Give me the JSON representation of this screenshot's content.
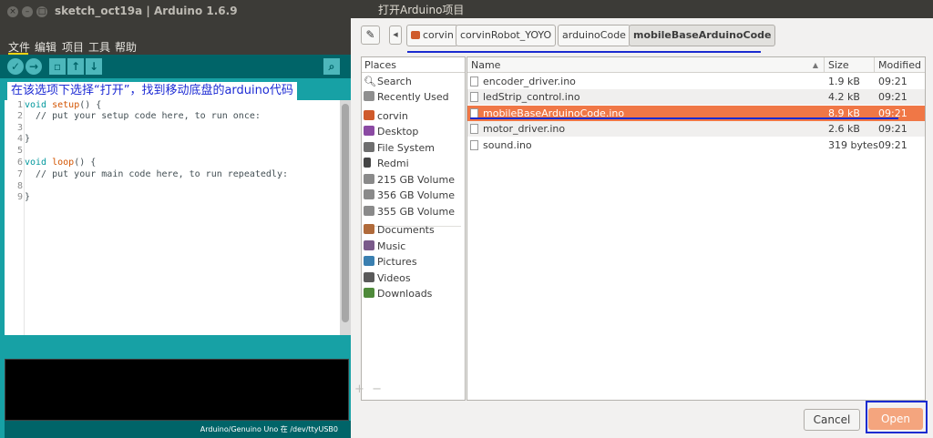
{
  "ide": {
    "title": "sketch_oct19a | Arduino 1.6.9",
    "menu": [
      "文件",
      "编辑",
      "项目",
      "工具",
      "帮助"
    ],
    "annotation": "在该选项下选择“打开”，找到移动底盘的arduino代码",
    "line_numbers": [
      "1",
      "2",
      "3",
      "4",
      "5",
      "6",
      "7",
      "8",
      "9"
    ],
    "code": {
      "l1_kw": "void",
      "l1_fn": "setup",
      "l1_rest": "() {",
      "l2": "  // put your setup code here, to run once:",
      "l4": "}",
      "l6_kw": "void",
      "l6_fn": "loop",
      "l6_rest": "() {",
      "l7": "  // put your main code here, to run repeatedly:",
      "l9": "}"
    },
    "status": "Arduino/Genuino Uno 在 /dev/ttyUSB0"
  },
  "dialog": {
    "title": "打开Arduino项目",
    "breadcrumbs": [
      "corvin",
      "corvinRobot_YOYO",
      "arduinoCode",
      "mobileBaseArduinoCode"
    ],
    "places_header": "Places",
    "places": [
      {
        "label": "Search",
        "icon": "search-icon"
      },
      {
        "label": "Recently Used",
        "icon": "recent-icon"
      },
      {
        "label": "corvin",
        "icon": "home-folder-icon"
      },
      {
        "label": "Desktop",
        "icon": "desktop-icon"
      },
      {
        "label": "File System",
        "icon": "filesystem-icon"
      },
      {
        "label": "Redmi",
        "icon": "phone-icon"
      },
      {
        "label": "215 GB Volume",
        "icon": "drive-icon"
      },
      {
        "label": "356 GB Volume",
        "icon": "drive-icon"
      },
      {
        "label": "355 GB Volume",
        "icon": "drive-icon"
      },
      {
        "label": "Documents",
        "icon": "documents-folder-icon"
      },
      {
        "label": "Music",
        "icon": "music-folder-icon"
      },
      {
        "label": "Pictures",
        "icon": "pictures-folder-icon"
      },
      {
        "label": "Videos",
        "icon": "videos-folder-icon"
      },
      {
        "label": "Downloads",
        "icon": "downloads-folder-icon"
      }
    ],
    "columns": {
      "name": "Name",
      "size": "Size",
      "modified": "Modified"
    },
    "files": [
      {
        "name": "encoder_driver.ino",
        "size": "1.9 kB",
        "modified": "09:21"
      },
      {
        "name": "ledStrip_control.ino",
        "size": "4.2 kB",
        "modified": "09:21"
      },
      {
        "name": "mobileBaseArduinoCode.ino",
        "size": "8.9 kB",
        "modified": "09:21",
        "selected": true
      },
      {
        "name": "motor_driver.ino",
        "size": "2.6 kB",
        "modified": "09:21"
      },
      {
        "name": "sound.ino",
        "size": "319 bytes",
        "modified": "09:21"
      }
    ],
    "cancel_label": "Cancel",
    "open_label": "Open",
    "accent_color": "#f07746",
    "annotation_color": "#1a2bd0"
  }
}
